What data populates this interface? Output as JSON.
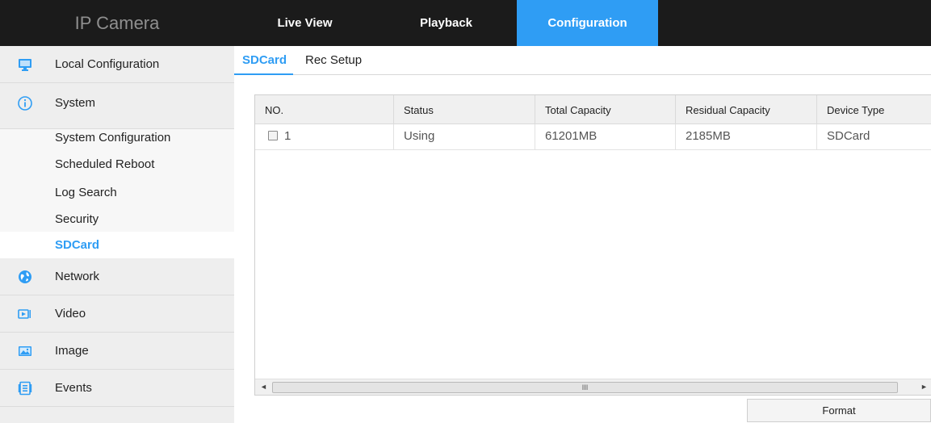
{
  "header": {
    "brand": "IP Camera",
    "nav": [
      {
        "label": "Live View",
        "active": false
      },
      {
        "label": "Playback",
        "active": false
      },
      {
        "label": "Configuration",
        "active": true
      }
    ]
  },
  "sidebar": {
    "local": {
      "label": "Local Configuration",
      "icon": "monitor-icon"
    },
    "system": {
      "label": "System",
      "icon": "info-icon"
    },
    "system_sub": [
      {
        "label": "System Configuration"
      },
      {
        "label": "Scheduled Reboot"
      },
      {
        "label": "Log Search"
      },
      {
        "label": "Security"
      },
      {
        "label": "SDCard",
        "active": true
      }
    ],
    "network": {
      "label": "Network",
      "icon": "globe-icon"
    },
    "video": {
      "label": "Video",
      "icon": "video-icon"
    },
    "image": {
      "label": "Image",
      "icon": "image-icon"
    },
    "events": {
      "label": "Events",
      "icon": "events-icon"
    }
  },
  "tabs": [
    {
      "label": "SDCard",
      "active": true
    },
    {
      "label": "Rec Setup",
      "active": false
    }
  ],
  "table": {
    "columns": [
      "NO.",
      "Status",
      "Total Capacity",
      "Residual Capacity",
      "Device Type"
    ],
    "rows": [
      {
        "no": "1",
        "status": "Using",
        "total": "61201MB",
        "residual": "2185MB",
        "type": "SDCard",
        "checked": false
      }
    ]
  },
  "scrollbar": {
    "left_arrow": "◄",
    "right_arrow": "►",
    "grip": "III"
  },
  "format_button": "Format",
  "colors": {
    "accent": "#2f9df4",
    "topbar": "#1b1b1b",
    "sidebar": "#eeeeee"
  }
}
